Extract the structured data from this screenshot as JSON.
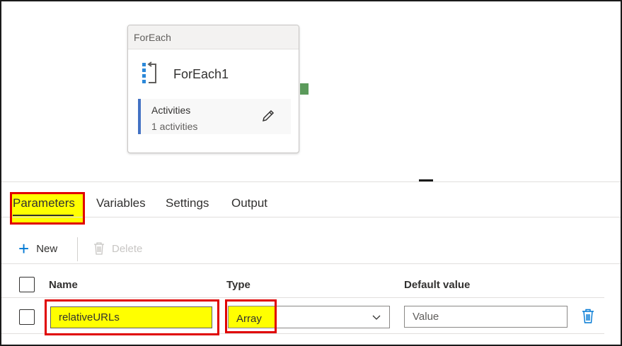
{
  "canvas": {
    "activity": {
      "type_label": "ForEach",
      "name": "ForEach1",
      "activities_title": "Activities",
      "activities_count": "1 activities",
      "icon": "foreach-icon",
      "edit_icon": "pencil-icon"
    },
    "colors": {
      "activities_accent": "#4472c4",
      "output_port": "#5b9a5b"
    }
  },
  "tabs": [
    {
      "label": "Parameters",
      "selected": true
    },
    {
      "label": "Variables",
      "selected": false
    },
    {
      "label": "Settings",
      "selected": false
    },
    {
      "label": "Output",
      "selected": false
    }
  ],
  "toolbar": {
    "new_label": "New",
    "new_icon": "plus-icon",
    "delete_label": "Delete",
    "delete_icon": "trash-icon",
    "delete_enabled": false
  },
  "table": {
    "headers": {
      "name": "Name",
      "type": "Type",
      "default": "Default value"
    },
    "rows": [
      {
        "name": "relativeURLs",
        "type": "Array",
        "default_placeholder": "Value",
        "default_value": ""
      }
    ]
  },
  "highlight": {
    "color": "#e00000",
    "fill": "#ffff00"
  }
}
